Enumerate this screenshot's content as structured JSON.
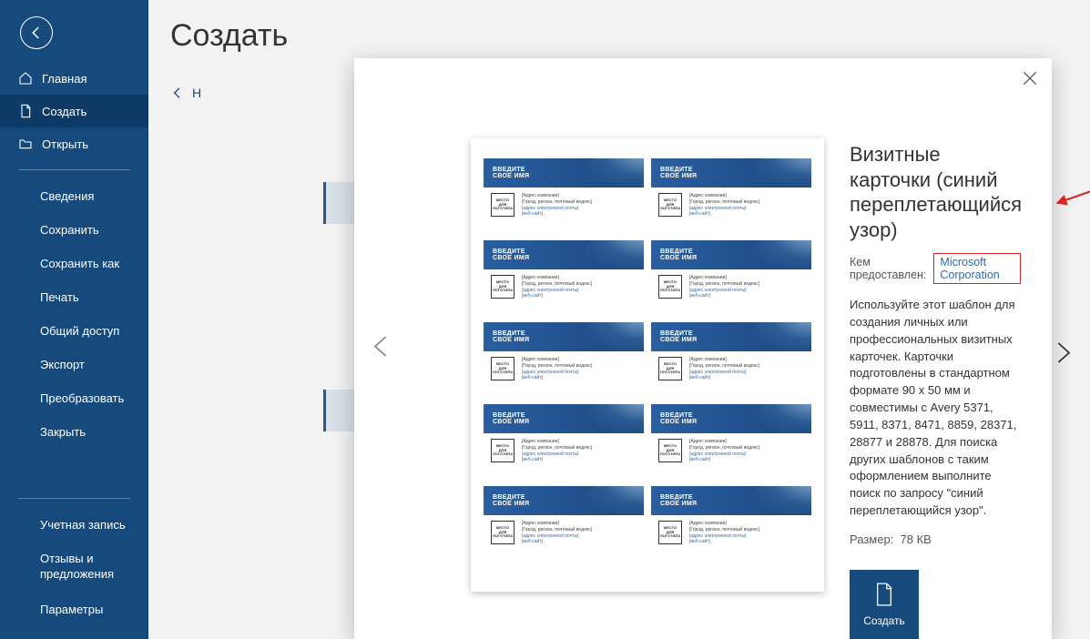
{
  "page_title": "Создать",
  "nav_back_hint": "Н",
  "sidebar": {
    "items": [
      {
        "label": "Главная",
        "icon": "home"
      },
      {
        "label": "Создать",
        "icon": "doc"
      },
      {
        "label": "Открыть",
        "icon": "folder"
      }
    ],
    "sub": [
      "Сведения",
      "Сохранить",
      "Сохранить как",
      "Печать",
      "Общий доступ",
      "Экспорт",
      "Преобразовать",
      "Закрыть"
    ],
    "footer": [
      "Учетная запись",
      "Отзывы и предложения",
      "Параметры"
    ]
  },
  "template": {
    "title": "Визитные карточки (синий переплетающийся узор)",
    "provided_label": "Кем предоставлен:",
    "provider": "Microsoft Corporation",
    "description": "Используйте этот шаблон для создания личных или профессиональных визитных карточек. Карточки подготовлены в стандартном формате 90 x 50 мм и совместимы с Avery 5371, 5911, 8371, 8471, 8859, 28371, 28877 и 28878. Для поиска других шаблонов с таким оформлением выполните поиск по запросу \"синий переплетающийся узор\".",
    "size_label": "Размер:",
    "size_value": "78 КВ",
    "create_label": "Создать"
  },
  "card": {
    "title_l1": "ВВЕДИТЕ",
    "title_l2": "СВОЕ ИМЯ",
    "logo_l1": "МЕСТО",
    "logo_l2": "ДЛЯ",
    "logo_l3": "ЛОГОТИПА",
    "addr1": "[Адрес компании]",
    "addr2": "[Город, регион, почтовый индекс]",
    "email": "[адрес электронной почты]",
    "web": "[веб-сайт]"
  }
}
